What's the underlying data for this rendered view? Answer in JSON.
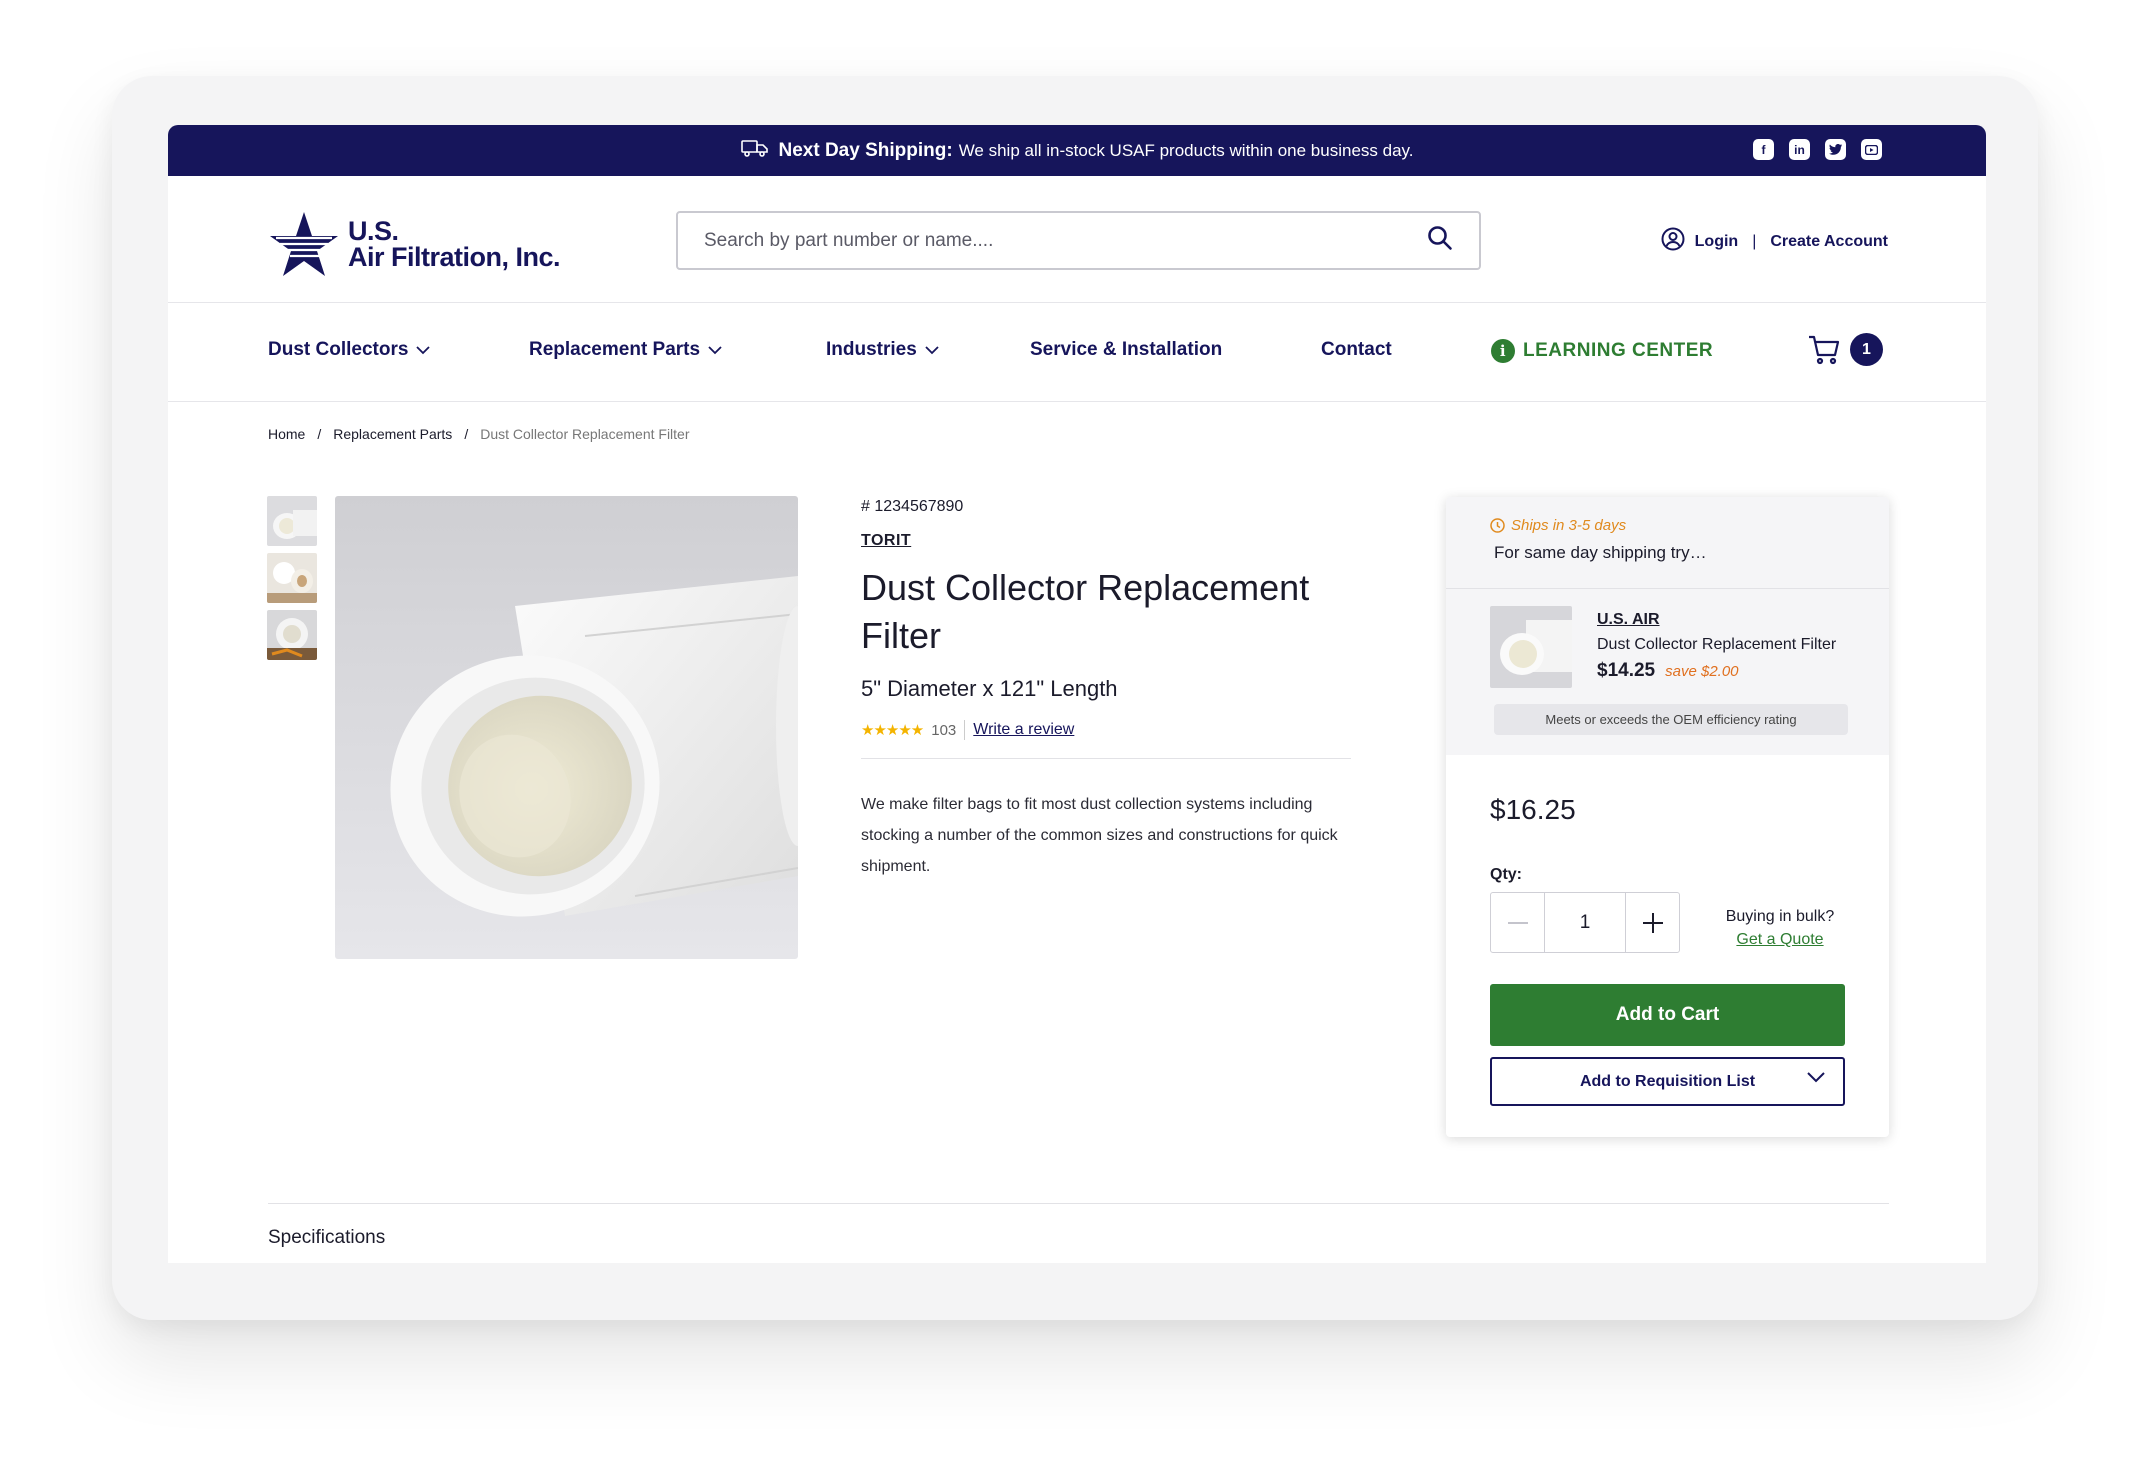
{
  "topbar": {
    "shipping_bold": "Next Day Shipping:",
    "shipping_text": "We ship all in-stock USAF products within one business day.",
    "socials": [
      "facebook-icon",
      "linkedin-icon",
      "twitter-icon",
      "youtube-icon"
    ],
    "bg_color": "#16155b"
  },
  "header": {
    "logo_line1": "U.S.",
    "logo_line2": "Air Filtration, Inc.",
    "search_placeholder": "Search by part number or name....",
    "login": "Login",
    "separator": "|",
    "create_account": "Create Account"
  },
  "nav": {
    "items": [
      "Dust Collectors",
      "Replacement Parts",
      "Industries",
      "Service & Installation",
      "Contact"
    ],
    "learning_center": "LEARNING CENTER",
    "cart_count": "1"
  },
  "breadcrumb": {
    "home": "Home",
    "sep": "/",
    "category": "Replacement Parts",
    "current": "Dust Collector Replacement Filter"
  },
  "product": {
    "sku": "# 1234567890",
    "brand": "TORIT",
    "title": "Dust Collector Replacement Filter",
    "subtitle": "5\" Diameter x 121\" Length",
    "rating_count": "103",
    "write_review": "Write a review",
    "description": "We make filter bags to fit most dust collection systems including stocking a number of the common sizes and constructions for quick shipment."
  },
  "panel": {
    "ships": "Ships in 3-5 days",
    "same_day": "For same day shipping try…",
    "alt_brand": "U.S. AIR",
    "alt_name": "Dust Collector Replacement Filter",
    "alt_price": "$14.25",
    "alt_save": "save $2.00",
    "oem_note": "Meets or exceeds the OEM efficiency rating",
    "price": "$16.25",
    "qty_label": "Qty:",
    "qty_value": "1",
    "bulk_text": "Buying in bulk?",
    "quote_link": "Get a Quote",
    "add_to_cart": "Add to Cart",
    "add_to_requisition": "Add to Requisition List"
  },
  "specs": {
    "title": "Specifications"
  },
  "colors": {
    "brand_navy": "#16155b",
    "accent_green": "#2e7d32",
    "save_orange": "#e07020"
  }
}
